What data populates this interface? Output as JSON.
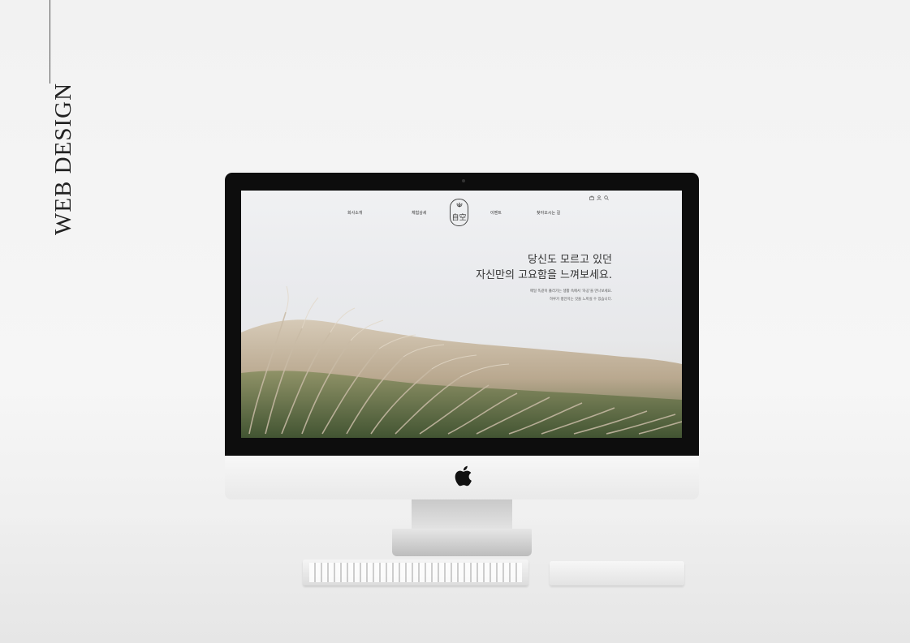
{
  "side_label": {
    "title": "WEB DESIGN"
  },
  "site": {
    "nav": [
      "회사소개",
      "체험상세",
      "이벤트",
      "찾아오시는 길"
    ],
    "logo_text": "自空",
    "utility_icons": [
      "bag-icon",
      "user-icon",
      "search-icon"
    ],
    "hero": {
      "headline_line1": "당신도 모르고 있던",
      "headline_line2": "자신만의 고요함을 느껴보세요.",
      "desc_line1": "매일 똑같이 흘러가는 생활 속에서 '자공'을 만나보세요.",
      "desc_line2": "하루가 평안지는 것을 느끼실 수 있습니다."
    }
  },
  "colors": {
    "background": "#f2f2f2",
    "screen_sky": "#e9eaed",
    "grass": "#c2b3a0",
    "bezel": "#0d0d0d"
  }
}
